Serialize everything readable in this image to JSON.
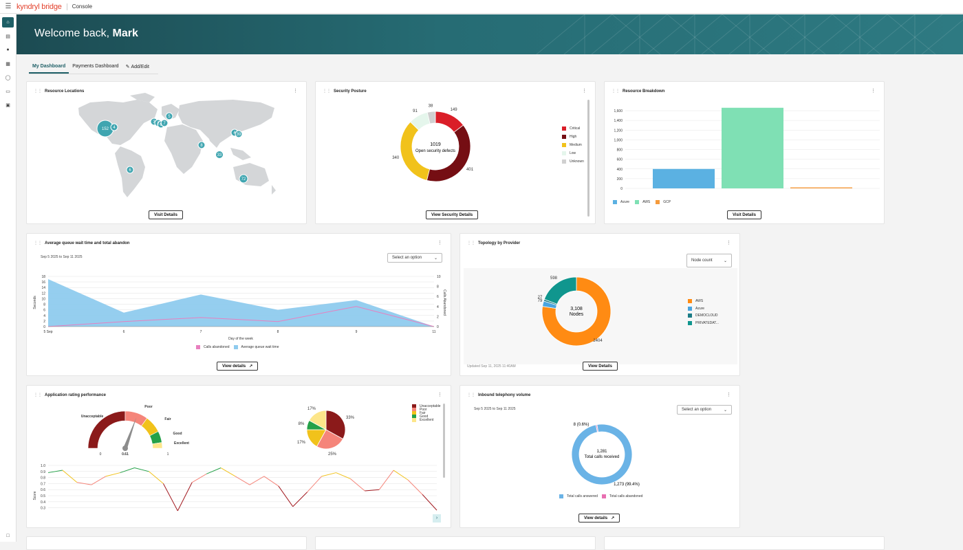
{
  "app": {
    "brand": "kyndryl bridge",
    "section": "Console"
  },
  "hero": {
    "greeting": "Welcome back, ",
    "name": "Mark"
  },
  "tabs": [
    {
      "label": "My Dashboard",
      "active": true
    },
    {
      "label": "Payments Dashboard"
    },
    {
      "label": "Add/Edit"
    }
  ],
  "resource_locations": {
    "title": "Resource Locations",
    "button": "Visit Details",
    "markers": [
      {
        "label": "152",
        "region": "North America"
      },
      {
        "label": "4",
        "region": "North America"
      },
      {
        "label": "3",
        "region": "UK"
      },
      {
        "label": "2",
        "region": "UK"
      },
      {
        "label": "6",
        "region": "Europe"
      },
      {
        "label": "7",
        "region": "Europe"
      },
      {
        "label": "5",
        "region": "Northern Europe"
      },
      {
        "label": "8",
        "region": "India"
      },
      {
        "label": "4",
        "region": "East Asia"
      },
      {
        "label": "39",
        "region": "East Asia"
      },
      {
        "label": "33",
        "region": "Southeast Asia"
      },
      {
        "label": "6",
        "region": "South America"
      },
      {
        "label": "72",
        "region": "Australia"
      }
    ]
  },
  "security_posture": {
    "title": "Security Posture",
    "button": "View Security Details",
    "center_value": "1019",
    "center_label": "Open security defects",
    "chart_data": {
      "type": "pie",
      "donut": true,
      "categories": [
        "Critical",
        "High",
        "Medium",
        "Low",
        "Unknown"
      ],
      "values": [
        149,
        401,
        340,
        91,
        38
      ],
      "colors": [
        "#da1e28",
        "#750e13",
        "#f1c21b",
        "#e5f6ec",
        "#d0d0d0"
      ],
      "legend": "right"
    }
  },
  "resource_breakdown": {
    "title": "Resource Breakdown",
    "button": "Visit Details",
    "chart_data": {
      "type": "bar",
      "categories": [
        "Azure",
        "AWS",
        "GCP"
      ],
      "values": [
        400,
        1660,
        20
      ],
      "colors": [
        "#5bb1e2",
        "#7fe0b4",
        "#f59a3c"
      ],
      "yticks": [
        "0",
        "200",
        "400",
        "600",
        "800",
        "1,000",
        "1,200",
        "1,400",
        "1,600"
      ],
      "ylim": [
        0,
        1600
      ],
      "grid": true,
      "legend": "bottom-left"
    }
  },
  "queue_wait": {
    "title": "Average queue wait time and total abandon",
    "date_range": "Sep 5 2025 to Sep 11 2025",
    "select_placeholder": "Select an option",
    "button": "View details",
    "chart_data": {
      "type": "area",
      "x": [
        "5 Sep",
        "6",
        "7",
        "8",
        "9",
        "11"
      ],
      "series": [
        {
          "name": "Average queue wait time",
          "axis": "left",
          "values": [
            17,
            5,
            11.5,
            6,
            9.5,
            0
          ]
        },
        {
          "name": "Calls abandoned",
          "axis": "right",
          "values": [
            0,
            1,
            1.8,
            1,
            4,
            0
          ]
        }
      ],
      "xlabel": "Day of the week",
      "ylabel": "Seconds",
      "y2label": "Calls Abandoned",
      "yticks": [
        "0",
        "2",
        "4",
        "6",
        "8",
        "10",
        "12",
        "14",
        "16",
        "18"
      ],
      "y2ticks": [
        "0",
        "2",
        "4",
        "6",
        "8",
        "10"
      ],
      "ylim": [
        0,
        18
      ],
      "y2lim": [
        0,
        10
      ],
      "colors": [
        "#8fcbee",
        "#e87fbf"
      ],
      "legend": "bottom"
    }
  },
  "topology": {
    "title": "Topology by Provider",
    "select_value": "Node count",
    "center_value": "3,108",
    "center_label": "Nodes",
    "updated": "Updated Sep 11, 2025 11:40AM",
    "button": "View Details",
    "chart_data": {
      "type": "pie",
      "donut": true,
      "categories": [
        "AWS",
        "Azure",
        "DEMOCLOUD",
        "PRIVATEDAT..."
      ],
      "values": [
        2404,
        79,
        27,
        598
      ],
      "slice_labels": [
        "2404",
        "79",
        "27",
        "598"
      ],
      "colors": [
        "#ff8b13",
        "#4aa5df",
        "#1c7c86",
        "#10968e"
      ],
      "legend": "right"
    }
  },
  "app_rating": {
    "title": "Application rating performance",
    "gauge": {
      "labels": [
        "Unacceptable",
        "Poor",
        "Fair",
        "Good",
        "Excellent"
      ],
      "min": "0",
      "max": "1",
      "value": "0.61",
      "colors": [
        "#8b1a1a",
        "#f5857a",
        "#f1c21b",
        "#24a148",
        "#fde68a"
      ]
    },
    "pie": {
      "labels": [
        "33%",
        "25%",
        "17%",
        "8%",
        "17%"
      ],
      "values": [
        33,
        25,
        17,
        8,
        17
      ],
      "colors": [
        "#8b1a1a",
        "#f5857a",
        "#f1c21b",
        "#24a148",
        "#fde68a"
      ]
    },
    "legend": [
      "Unacceptable",
      "Poor",
      "Fair",
      "Good",
      "Excellent"
    ],
    "line": {
      "ylabel": "Score",
      "yticks": [
        "0.3",
        "0.4",
        "0.5",
        "0.6",
        "0.7",
        "0.8",
        "0.9",
        "1.0"
      ],
      "ylim": [
        0.25,
        1.0
      ],
      "values": [
        0.88,
        0.92,
        0.72,
        0.68,
        0.82,
        0.88,
        0.96,
        0.9,
        0.7,
        0.25,
        0.72,
        0.86,
        0.96,
        0.82,
        0.68,
        0.82,
        0.66,
        0.32,
        0.56,
        0.82,
        0.88,
        0.78,
        0.58,
        0.6,
        0.92,
        0.76,
        0.52,
        0.26
      ]
    }
  },
  "telephony": {
    "title": "Inbound telephony volume",
    "date_range": "Sep 5 2025 to Sep 11 2025",
    "select_placeholder": "Select an option",
    "center_value": "1,281",
    "center_label": "Total calls received",
    "label_abandoned": "8 (0.6%)",
    "label_answered": "1,273 (99.4%)",
    "button": "View details",
    "chart_data": {
      "type": "pie",
      "donut": true,
      "categories": [
        "Total calls answered",
        "Total calls abandoned"
      ],
      "values": [
        1273,
        8
      ],
      "colors": [
        "#6ab3e6",
        "#e86fb1"
      ],
      "legend": "bottom"
    }
  }
}
